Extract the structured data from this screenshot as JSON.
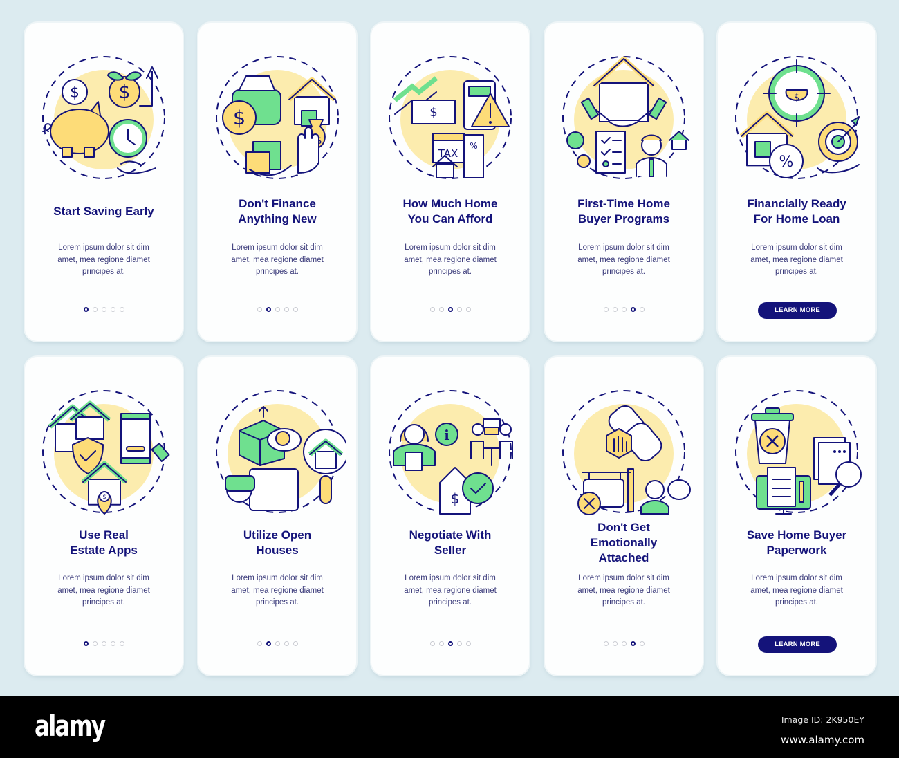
{
  "colors": {
    "navy": "#14137a",
    "green": "#6fe08f",
    "yellow": "#fddc78",
    "yellow_light": "#fcecae",
    "background": "#dcebf0",
    "card": "#fdfefe"
  },
  "cards": [
    {
      "title_lines": [
        "Start Saving Early"
      ],
      "description": [
        "Lorem ipsum dolor sit dim",
        "amet, mea regione diamet",
        "principes at."
      ],
      "active_step": 1,
      "total_steps": 5,
      "icon": "piggy-bank-savings-icon"
    },
    {
      "title_lines": [
        "Don't Finance",
        "Anything New"
      ],
      "description": [
        "Lorem ipsum dolor sit dim",
        "amet, mea regione diamet",
        "principes at."
      ],
      "active_step": 2,
      "total_steps": 5,
      "icon": "car-house-shopping-stop-icon"
    },
    {
      "title_lines": [
        "How Much Home",
        "You Can Afford"
      ],
      "description": [
        "Lorem ipsum dolor sit dim",
        "amet, mea regione diamet",
        "principes at."
      ],
      "active_step": 3,
      "total_steps": 5,
      "icon": "calculator-tax-warning-icon"
    },
    {
      "title_lines": [
        "First-Time Home",
        "Buyer Programs"
      ],
      "description": [
        "Lorem ipsum dolor sit dim",
        "amet, mea regione diamet",
        "principes at."
      ],
      "active_step": 4,
      "total_steps": 5,
      "icon": "handshake-checklist-agent-icon"
    },
    {
      "title_lines": [
        "Financially Ready",
        "For Home Loan"
      ],
      "description": [
        "Lorem ipsum dolor sit dim",
        "amet, mea regione diamet",
        "principes at."
      ],
      "button_label": "LEARN MORE",
      "icon": "wallet-target-loan-icon"
    },
    {
      "title_lines": [
        "Use Real",
        "Estate Apps"
      ],
      "description": [
        "Lorem ipsum dolor sit dim",
        "amet, mea regione diamet",
        "principes at."
      ],
      "active_step": 1,
      "total_steps": 5,
      "icon": "real-estate-app-icon"
    },
    {
      "title_lines": [
        "Utilize Open",
        "Houses"
      ],
      "description": [
        "Lorem ipsum dolor sit dim",
        "amet, mea regione diamet",
        "principes at."
      ],
      "active_step": 2,
      "total_steps": 5,
      "icon": "virtual-tour-vr-icon"
    },
    {
      "title_lines": [
        "Negotiate With",
        "Seller"
      ],
      "description": [
        "Lorem ipsum dolor sit dim",
        "amet, mea regione diamet",
        "principes at."
      ],
      "active_step": 3,
      "total_steps": 5,
      "icon": "negotiation-price-tag-icon"
    },
    {
      "title_lines": [
        "Don't Get",
        "Emotionally",
        "Attached"
      ],
      "description": [
        "Lorem ipsum dolor sit dim",
        "amet, mea regione diamet",
        "principes at."
      ],
      "active_step": 4,
      "total_steps": 5,
      "icon": "stop-attachment-chain-icon"
    },
    {
      "title_lines": [
        "Save Home Buyer",
        "Paperwork"
      ],
      "description": [
        "Lorem ipsum dolor sit dim",
        "amet, mea regione diamet",
        "principes at."
      ],
      "button_label": "LEARN MORE",
      "icon": "documents-paperwork-icon"
    }
  ],
  "footer": {
    "brand": "alamy",
    "image_id": "Image ID: 2K950EY",
    "website": "www.alamy.com"
  }
}
